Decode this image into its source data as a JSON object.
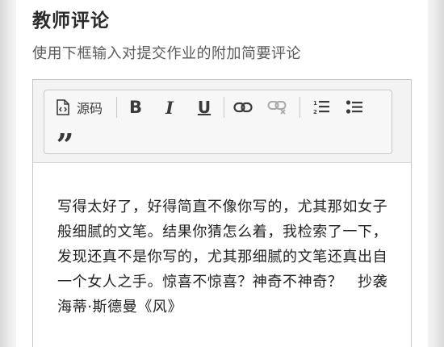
{
  "section": {
    "title": "教师评论",
    "description": "使用下框输入对提交作业的附加简要评论"
  },
  "toolbar": {
    "source_label": "源码",
    "bold_label": "B",
    "italic_label": "I",
    "underline_label": "U",
    "quote_label": "”",
    "icons": [
      "source-icon",
      "link-icon",
      "unlink-icon",
      "ordered-list-icon",
      "bulleted-list-icon"
    ]
  },
  "editor": {
    "content": "写得太好了，好得简直不像你写的，尤其那如女子般细腻的文笔。结果你猜怎么着，我检索了一下，发现还真不是你写的，尤其那细腻的文笔还真出自一个女人之手。惊喜不惊喜？神奇不神奇？　抄袭海蒂·斯德曼《风》"
  },
  "colors": {
    "text": "#222222",
    "toolbar_bg": "#f7f7f7",
    "border": "#c6c6c6"
  }
}
